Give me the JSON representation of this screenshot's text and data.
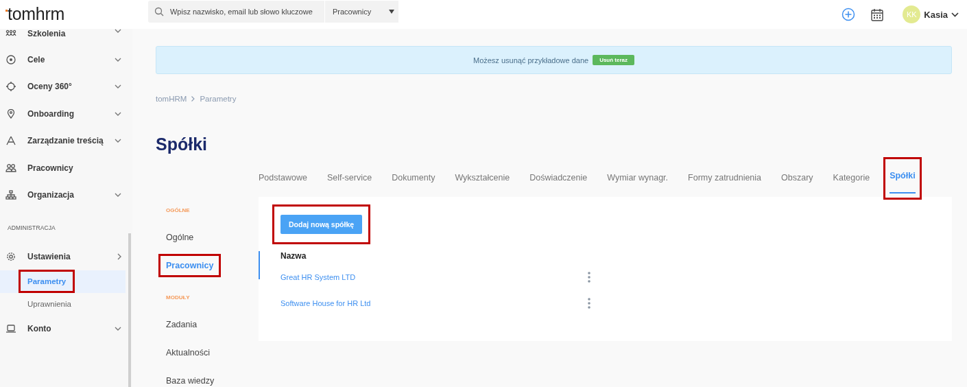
{
  "header": {
    "logo": "tomhrm",
    "search": {
      "placeholder": "Wpisz nazwisko, email lub słowo kluczowe"
    },
    "search_scope": "Pracownicy",
    "user": {
      "initials": "KK",
      "name": "Kasia"
    }
  },
  "sidebar": {
    "items": [
      {
        "label": "Szkolenia",
        "expanded": false,
        "selected": false
      },
      {
        "label": "Cele",
        "expanded": false,
        "selected": false
      },
      {
        "label": "Oceny 360°",
        "expanded": false,
        "selected": false
      },
      {
        "label": "Onboarding",
        "expanded": false,
        "selected": false
      },
      {
        "label": "Zarządzanie treścią",
        "expanded": false,
        "selected": false
      },
      {
        "label": "Pracownicy",
        "selected": false
      },
      {
        "label": "Organizacja",
        "expanded": false,
        "selected": false
      }
    ],
    "section_title": "ADMINISTRACJA",
    "admin_items": [
      {
        "label": "Ustawienia",
        "expanded": true,
        "selected": false,
        "children": [
          {
            "label": "Parametry",
            "selected": true,
            "highlighted": true
          },
          {
            "label": "Uprawnienia",
            "selected": false,
            "highlighted": false
          }
        ]
      },
      {
        "label": "Konto",
        "expanded": false,
        "selected": false
      }
    ]
  },
  "banner": {
    "message": "Możesz usunąć przykładowe dane",
    "action": "Usuń teraz"
  },
  "breadcrumb": [
    "tomHRM",
    "Parametry"
  ],
  "title": "Spółki",
  "subnav": {
    "sections": [
      {
        "title": "OGÓLNE",
        "items": [
          {
            "label": "Ogólne",
            "selected": false,
            "highlighted": false
          },
          {
            "label": "Pracownicy",
            "selected": true,
            "highlighted": true
          }
        ]
      },
      {
        "title": "MODUŁY",
        "items": [
          {
            "label": "Zadania",
            "selected": false,
            "highlighted": false
          },
          {
            "label": "Aktualności",
            "selected": false,
            "highlighted": false
          },
          {
            "label": "Baza wiedzy",
            "selected": false,
            "highlighted": false
          }
        ]
      }
    ]
  },
  "tabs": [
    {
      "label": "Podstawowe",
      "selected": false,
      "highlighted": false
    },
    {
      "label": "Self-service",
      "selected": false,
      "highlighted": false
    },
    {
      "label": "Dokumenty",
      "selected": false,
      "highlighted": false
    },
    {
      "label": "Wykształcenie",
      "selected": false,
      "highlighted": false
    },
    {
      "label": "Doświadczenie",
      "selected": false,
      "highlighted": false
    },
    {
      "label": "Wymiar wynagr.",
      "selected": false,
      "highlighted": false
    },
    {
      "label": "Formy zatrudnienia",
      "selected": false,
      "highlighted": false
    },
    {
      "label": "Obszary",
      "selected": false,
      "highlighted": false
    },
    {
      "label": "Kategorie",
      "selected": false,
      "highlighted": false
    },
    {
      "label": "Spółki",
      "selected": true,
      "highlighted": true
    }
  ],
  "card": {
    "add_button": {
      "label": "Dodaj nową spółkę",
      "highlighted": true
    },
    "table": {
      "columns": [
        "Nazwa"
      ],
      "rows": [
        {
          "name": "Great HR System LTD"
        },
        {
          "name": "Software House for HR Ltd"
        }
      ]
    }
  }
}
